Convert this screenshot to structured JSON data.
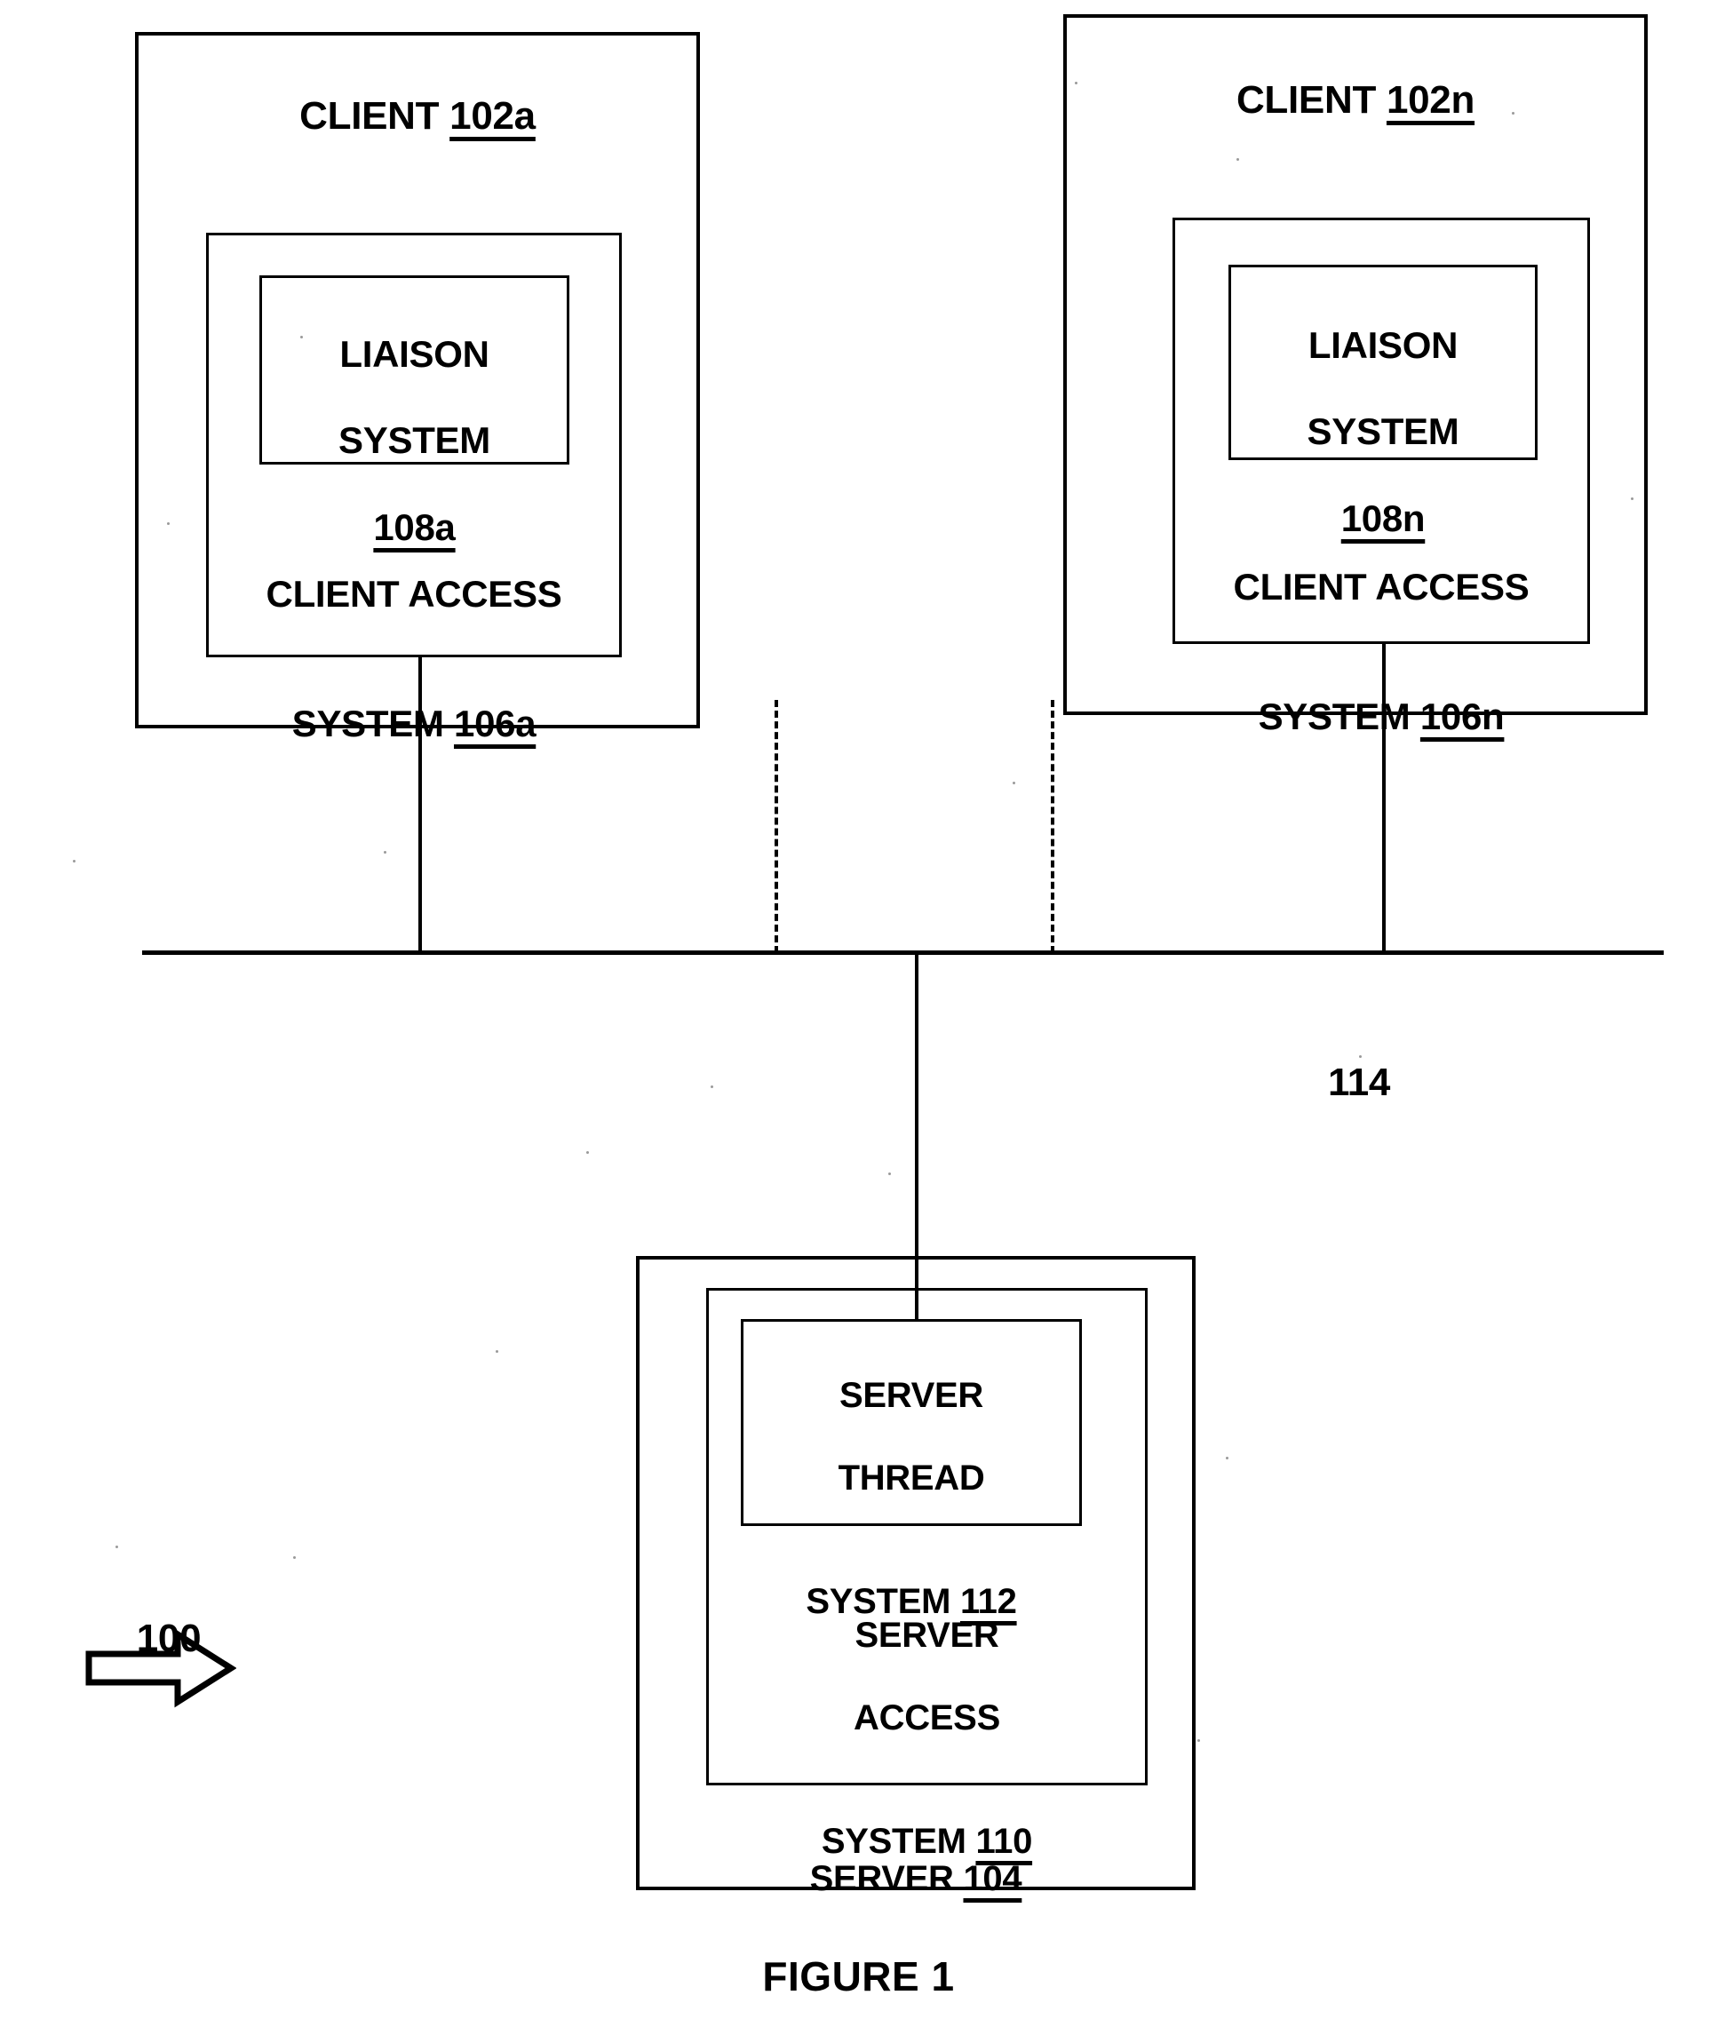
{
  "figure": {
    "caption": "FIGURE 1",
    "system_ref": "100"
  },
  "network": {
    "bus_label": "114"
  },
  "clients": [
    {
      "title": "CLIENT",
      "ref": "102a",
      "access_system": {
        "line1": "CLIENT ACCESS",
        "line2": "SYSTEM",
        "ref": "106a"
      },
      "liaison_system": {
        "line1": "LIAISON",
        "line2": "SYSTEM",
        "ref": "108a"
      }
    },
    {
      "title": "CLIENT",
      "ref": "102n",
      "access_system": {
        "line1": "CLIENT ACCESS",
        "line2": "SYSTEM",
        "ref": "106n"
      },
      "liaison_system": {
        "line1": "LIAISON",
        "line2": "SYSTEM",
        "ref": "108n"
      }
    }
  ],
  "server": {
    "title": "SERVER",
    "ref": "104",
    "access_system": {
      "line1": "SERVER",
      "line2": "ACCESS",
      "line3": "SYSTEM",
      "ref": "110"
    },
    "thread_system": {
      "line1": "SERVER",
      "line2": "THREAD",
      "line3": "SYSTEM",
      "ref": "112"
    }
  },
  "colors": {
    "ink": "#000000",
    "paper": "#ffffff"
  }
}
